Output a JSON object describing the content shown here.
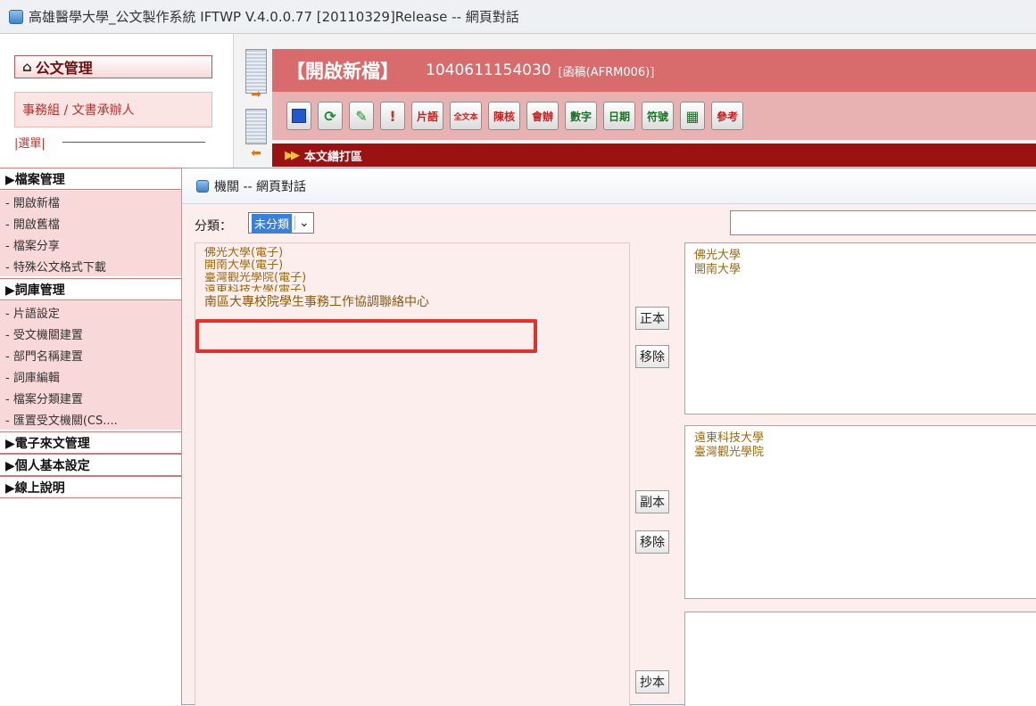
{
  "window": {
    "title": "高雄醫學大學_公文製作系統 IFTWP V.4.0.0.77 [20110329]Release -- 網頁對話"
  },
  "sidebar": {
    "heading": "公文管理",
    "role": "事務組 / 文書承辦人",
    "menu_label": "|選單|",
    "categories": [
      {
        "label": "▶檔案管理"
      },
      {
        "label": "▶詞庫管理"
      },
      {
        "label": "▶電子來文管理"
      },
      {
        "label": "▶個人基本設定"
      },
      {
        "label": "▶線上說明"
      }
    ],
    "file_items": [
      "- 開啟新檔",
      "- 開啟舊檔",
      "- 檔案分享",
      "- 特殊公文格式下載"
    ],
    "lexicon_items": [
      "- 片語設定",
      "- 受文機關建置",
      "- 部門名稱建置",
      "- 詞庫編輯",
      "- 檔案分類建置",
      "- 匯置受文機關(CS...."
    ]
  },
  "header": {
    "title": "【開啟新檔】",
    "doc_number": "1040611154030",
    "doc_type": "[函稿(AFRM006)]"
  },
  "toolbar": {
    "buttons": [
      {
        "icon": "save-icon"
      },
      {
        "icon": "refresh-icon"
      },
      {
        "icon": "edit-icon"
      },
      {
        "icon": "alert-icon"
      },
      {
        "label": "片語"
      },
      {
        "label": "全文本"
      },
      {
        "label": "陳核"
      },
      {
        "label": "會辦"
      },
      {
        "label": "數字"
      },
      {
        "label": "日期"
      },
      {
        "label": "符號"
      },
      {
        "icon": "print-icon"
      },
      {
        "label": "參考"
      }
    ]
  },
  "section_bar": {
    "label": "本文繕打區"
  },
  "dialog": {
    "title": "機關 -- 網頁對話",
    "category_label": "分類：",
    "category_value": "未分類",
    "search_value": "",
    "source_items": [
      "佛光大學(電子)",
      "開南大學(電子)",
      "臺灣觀光學院(電子)",
      "遠東科技大學(電子)",
      "南區大專校院學生事務工作協調聯絡中心"
    ],
    "primary": {
      "label": "正本",
      "remove": "移除",
      "items": [
        "佛光大學",
        "開南大學"
      ]
    },
    "copy": {
      "label": "副本",
      "remove": "移除",
      "items": [
        "遠東科技大學",
        "臺灣觀光學院"
      ]
    },
    "cc": {
      "label": "抄本",
      "items": []
    }
  },
  "colors": {
    "header_red": "#d86c6c",
    "section_dark_red": "#9b1212",
    "highlight": "#e0312d",
    "item_text": "#9a6a10"
  }
}
